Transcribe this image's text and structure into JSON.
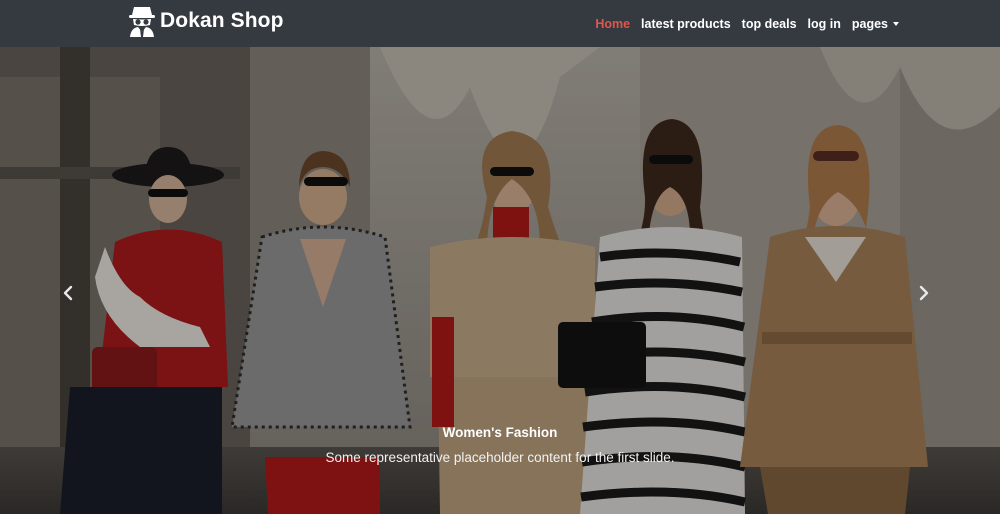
{
  "brand": {
    "name": "Dokan Shop",
    "icon": "spy-icon"
  },
  "nav": {
    "items": [
      {
        "label": "Home",
        "active": true
      },
      {
        "label": "latest products"
      },
      {
        "label": "top deals"
      },
      {
        "label": "log in"
      },
      {
        "label": "pages",
        "dropdown": true
      }
    ]
  },
  "carousel": {
    "slide": {
      "title": "Women's Fashion",
      "text": "Some representative placeholder content for the first slide.",
      "image": "five women walking on a city street in fashionable coats"
    },
    "prev_icon": "chevron-left-icon",
    "next_icon": "chevron-right-icon"
  },
  "colors": {
    "navbar_bg": "#343a40",
    "active_link": "#e0564c"
  }
}
